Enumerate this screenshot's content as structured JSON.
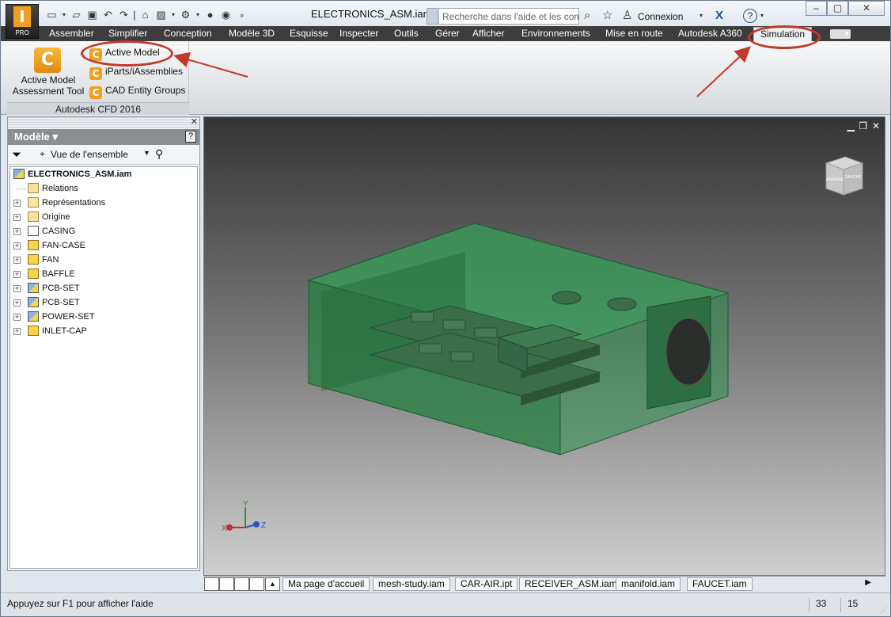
{
  "window": {
    "document_title": "ELECTRONICS_ASM.iam",
    "app_badge": "PRO",
    "search_placeholder": "Recherche dans l'aide et les com",
    "signin_label": "Connexion",
    "help_label": "?"
  },
  "ribbon_tabs": [
    "Assembler",
    "Simplifier",
    "Conception",
    "Modèle 3D",
    "Esquisse",
    "Inspecter",
    "Outils",
    "Gérer",
    "Afficher",
    "Environnements",
    "Mise en route",
    "Autodesk A360",
    "Simulation"
  ],
  "ribbon_panel": {
    "large_button_line1": "Active Model",
    "large_button_line2": "Assessment Tool",
    "buttons": [
      "Active Model",
      "iParts/iAssemblies",
      "CAD Entity Groups"
    ],
    "title": "Autodesk CFD 2016"
  },
  "browser": {
    "header": "Modèle ▾",
    "view_dropdown": "Vue de l'ensemble",
    "root": "ELECTRONICS_ASM.iam",
    "items": [
      {
        "label": "Relations",
        "icon": "folder-icon",
        "expandable": false
      },
      {
        "label": "Représentations",
        "icon": "representations-icon",
        "expandable": true
      },
      {
        "label": "Origine",
        "icon": "folder-icon",
        "expandable": true
      },
      {
        "label": "CASING",
        "icon": "cfd-part-icon",
        "expandable": true
      },
      {
        "label": "FAN-CASE",
        "icon": "part-icon",
        "expandable": true
      },
      {
        "label": "FAN",
        "icon": "part-icon",
        "expandable": true
      },
      {
        "label": "BAFFLE",
        "icon": "part-icon",
        "expandable": true
      },
      {
        "label": "PCB-SET",
        "icon": "subassembly-icon",
        "expandable": true
      },
      {
        "label": "PCB-SET",
        "icon": "subassembly-icon",
        "expandable": true
      },
      {
        "label": "POWER-SET",
        "icon": "subassembly-icon",
        "expandable": true
      },
      {
        "label": "INLET-CAP",
        "icon": "part-icon",
        "expandable": true
      }
    ]
  },
  "viewcube": {
    "faces": [
      "ARRIÈRE",
      "GAUCHE"
    ]
  },
  "axis_triad": {
    "x": "X",
    "y": "Y",
    "z": "Z"
  },
  "document_tabs": [
    "Ma page d'accueil",
    "mesh-study.iam",
    "CAR-AIR.ipt",
    "RECEIVER_ASM.iam",
    "manifold.iam",
    "FAUCET.iam"
  ],
  "status_bar": {
    "hint": "Appuyez sur F1 pour afficher l'aide",
    "count1": "33",
    "count2": "15"
  },
  "colors": {
    "ribbon_tab_bg": "#3d3d3d",
    "accent_orange": "#f0a020",
    "annotation_red": "#c0392b",
    "model_green": "#2e8b4a"
  }
}
